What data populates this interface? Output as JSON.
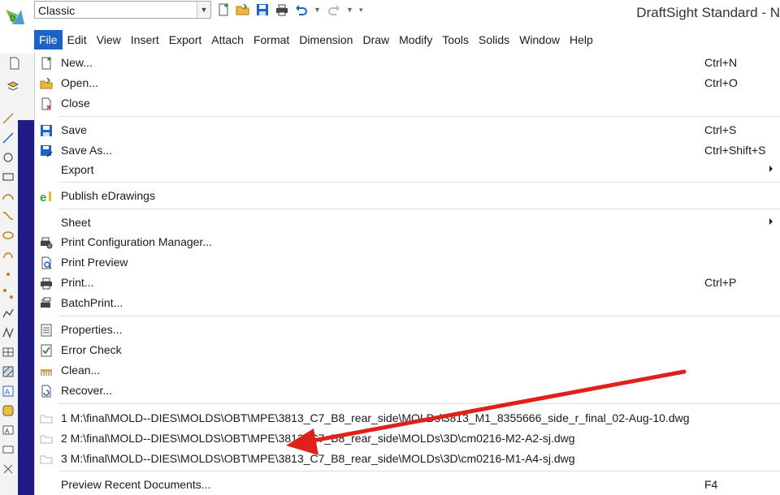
{
  "titlebar": {
    "workspace_value": "Classic",
    "app_title": "DraftSight Standard - N"
  },
  "menubar": {
    "items": [
      "File",
      "Edit",
      "View",
      "Insert",
      "Export",
      "Attach",
      "Format",
      "Dimension",
      "Draw",
      "Modify",
      "Tools",
      "Solids",
      "Window",
      "Help"
    ],
    "active": "File"
  },
  "filemenu": {
    "new": {
      "label": "New...",
      "shortcut": "Ctrl+N"
    },
    "open": {
      "label": "Open...",
      "shortcut": "Ctrl+O"
    },
    "close": {
      "label": "Close"
    },
    "save": {
      "label": "Save",
      "shortcut": "Ctrl+S"
    },
    "save_as": {
      "label": "Save As...",
      "shortcut": "Ctrl+Shift+S"
    },
    "export": {
      "label": "Export"
    },
    "publish": {
      "label": "Publish eDrawings"
    },
    "sheet": {
      "label": "Sheet"
    },
    "print_config": {
      "label": "Print Configuration Manager..."
    },
    "print_preview": {
      "label": "Print Preview"
    },
    "print": {
      "label": "Print...",
      "shortcut": "Ctrl+P"
    },
    "batch_print": {
      "label": "BatchPrint..."
    },
    "properties": {
      "label": "Properties..."
    },
    "error_check": {
      "label": "Error Check"
    },
    "clean": {
      "label": "Clean..."
    },
    "recover": {
      "label": "Recover..."
    },
    "recent": [
      "1 M:\\final\\MOLD--DIES\\MOLDS\\OBT\\MPE\\3813_C7_B8_rear_side\\MOLDs\\3813_M1_8355666_side_r_final_02-Aug-10.dwg",
      "2 M:\\final\\MOLD--DIES\\MOLDS\\OBT\\MPE\\3813_C7_B8_rear_side\\MOLDs\\3D\\cm0216-M2-A2-sj.dwg",
      "3 M:\\final\\MOLD--DIES\\MOLDS\\OBT\\MPE\\3813_C7_B8_rear_side\\MOLDs\\3D\\cm0216-M1-A4-sj.dwg"
    ],
    "preview_recent": {
      "label": "Preview Recent Documents...",
      "shortcut": "F4"
    }
  },
  "colors": {
    "menu_highlight": "#1c63c6",
    "arrow": "#e0201b",
    "canvas": "#1f1a84"
  }
}
